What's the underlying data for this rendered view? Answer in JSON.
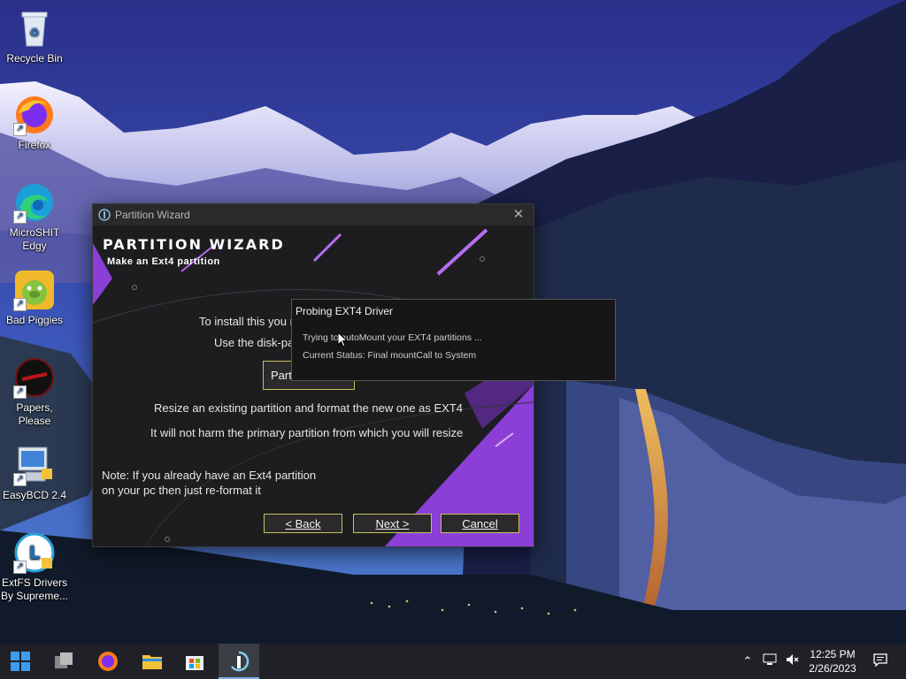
{
  "desktop_icons": [
    {
      "label": "Recycle Bin"
    },
    {
      "label": "Firefox"
    },
    {
      "label": "MicroSHIT Edgy"
    },
    {
      "label": "Bad Piggies"
    },
    {
      "label": "Papers, Please"
    },
    {
      "label": "EasyBCD 2.4"
    },
    {
      "label": "ExtFS Drivers By Supreme..."
    }
  ],
  "wizard": {
    "window_title": "Partition Wizard",
    "brand": "PARTITION WIZARD",
    "subtitle": "Make an Ext4 partition",
    "line1": "To install this you n",
    "line2": "Use the disk-pa",
    "partial_button": "Part",
    "resize_line": "Resize an existing partition and format the new one as EXT4",
    "harm_line": "It will not harm the primary partition from which you will resize",
    "note_line1": "Note: If you already have an Ext4 partition",
    "note_line2": "on your pc then just re-format it",
    "back_label": "< Back",
    "next_label": "Next >",
    "cancel_label": "Cancel"
  },
  "probe": {
    "title": "Probing EXT4 Driver",
    "line1": "Trying to autoMount your EXT4 partitions ...",
    "line2": "Current Status: Final mountCall to System"
  },
  "taskbar": {
    "apps": [
      "start-icon",
      "task-view-icon",
      "firefox-icon",
      "file-explorer-icon",
      "store-icon",
      "partition-wizard-icon"
    ],
    "time": "12:25 PM",
    "date": "2/26/2023"
  },
  "colors": {
    "wizard_purple": "#8b3fd6",
    "button_border": "#c8c05a",
    "taskbar": "#1f2127"
  }
}
